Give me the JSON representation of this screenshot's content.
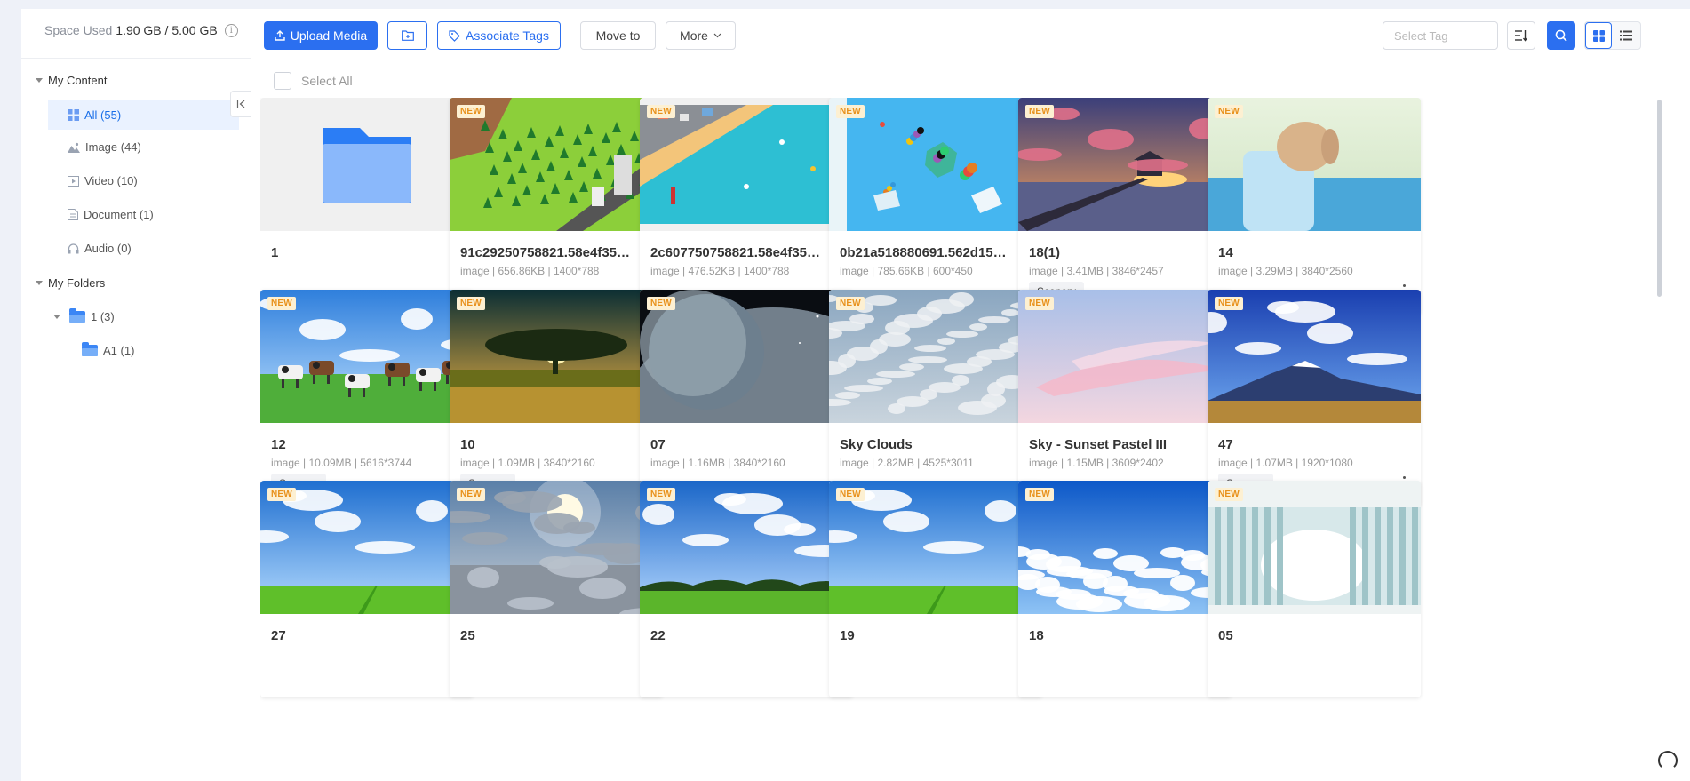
{
  "sidebar": {
    "space_used_label": "Space Used",
    "space_used_value": "1.90 GB / 5.00 GB",
    "my_content": "My Content",
    "items": [
      {
        "label": "All (55)",
        "icon": "grid-icon"
      },
      {
        "label": "Image (44)",
        "icon": "image-icon"
      },
      {
        "label": "Video (10)",
        "icon": "video-icon"
      },
      {
        "label": "Document (1)",
        "icon": "document-icon"
      },
      {
        "label": "Audio (0)",
        "icon": "audio-icon"
      }
    ],
    "my_folders": "My Folders",
    "folders": [
      {
        "label": "1 (3)"
      },
      {
        "label": "A1 (1)"
      }
    ]
  },
  "toolbar": {
    "upload": "Upload Media",
    "associate": "Associate Tags",
    "move_to": "Move to",
    "more": "More",
    "select_tag_placeholder": "Select Tag",
    "select_all": "Select All"
  },
  "colors": {
    "accent": "#2b6ff0",
    "new_badge": "#e8911c"
  },
  "new_badge": "NEW",
  "cards": [
    {
      "title": "1",
      "type": "folder"
    },
    {
      "title": "91c29250758821.58e4f35f15…",
      "meta": "image | 656.86KB | 1400*788",
      "tag": "-",
      "new": true,
      "scene": "iso-forest"
    },
    {
      "title": "2c607750758821.58e4f35f15…",
      "meta": "image | 476.52KB | 1400*788",
      "tag": "-",
      "new": true,
      "scene": "iso-beach"
    },
    {
      "title": "0b21a518880691.562d151db…",
      "meta": "image | 785.66KB | 600*450",
      "tag": "-",
      "new": true,
      "scene": "balls"
    },
    {
      "title": "18(1)",
      "meta": "image | 3.41MB | 3846*2457",
      "tag": "Scenery",
      "new": true,
      "scene": "pier-sunset"
    },
    {
      "title": "14",
      "meta": "image | 3.29MB | 3840*2560",
      "tag": "-",
      "new": true,
      "scene": "bunny"
    },
    {
      "title": "12",
      "meta": "image | 10.09MB | 5616*3744",
      "tag": "Scenery",
      "new": true,
      "scene": "cows"
    },
    {
      "title": "10",
      "meta": "image | 1.09MB | 3840*2160",
      "tag": "Scenery",
      "new": true,
      "scene": "tree-sunset"
    },
    {
      "title": "07",
      "meta": "image | 1.16MB | 3840*2160",
      "tag": "-",
      "new": true,
      "scene": "planet"
    },
    {
      "title": "Sky Clouds",
      "meta": "image | 2.82MB | 4525*3011",
      "tag": "-",
      "new": true,
      "scene": "sky-clouds"
    },
    {
      "title": "Sky - Sunset Pastel III",
      "meta": "image | 1.15MB | 3609*2402",
      "tag": "-",
      "new": true,
      "scene": "pastel"
    },
    {
      "title": "47",
      "meta": "image | 1.07MB | 1920*1080",
      "tag": "Scenery",
      "new": true,
      "scene": "mountain"
    },
    {
      "title": "27",
      "meta": "",
      "tag": "",
      "new": true,
      "scene": "field"
    },
    {
      "title": "25",
      "meta": "",
      "tag": "",
      "new": true,
      "scene": "sun-clouds"
    },
    {
      "title": "22",
      "meta": "",
      "tag": "",
      "new": true,
      "scene": "field-trees"
    },
    {
      "title": "19",
      "meta": "",
      "tag": "",
      "new": true,
      "scene": "field"
    },
    {
      "title": "18",
      "meta": "",
      "tag": "",
      "new": true,
      "scene": "above-clouds"
    },
    {
      "title": "05",
      "meta": "",
      "tag": "",
      "new": true,
      "scene": "columns"
    }
  ]
}
